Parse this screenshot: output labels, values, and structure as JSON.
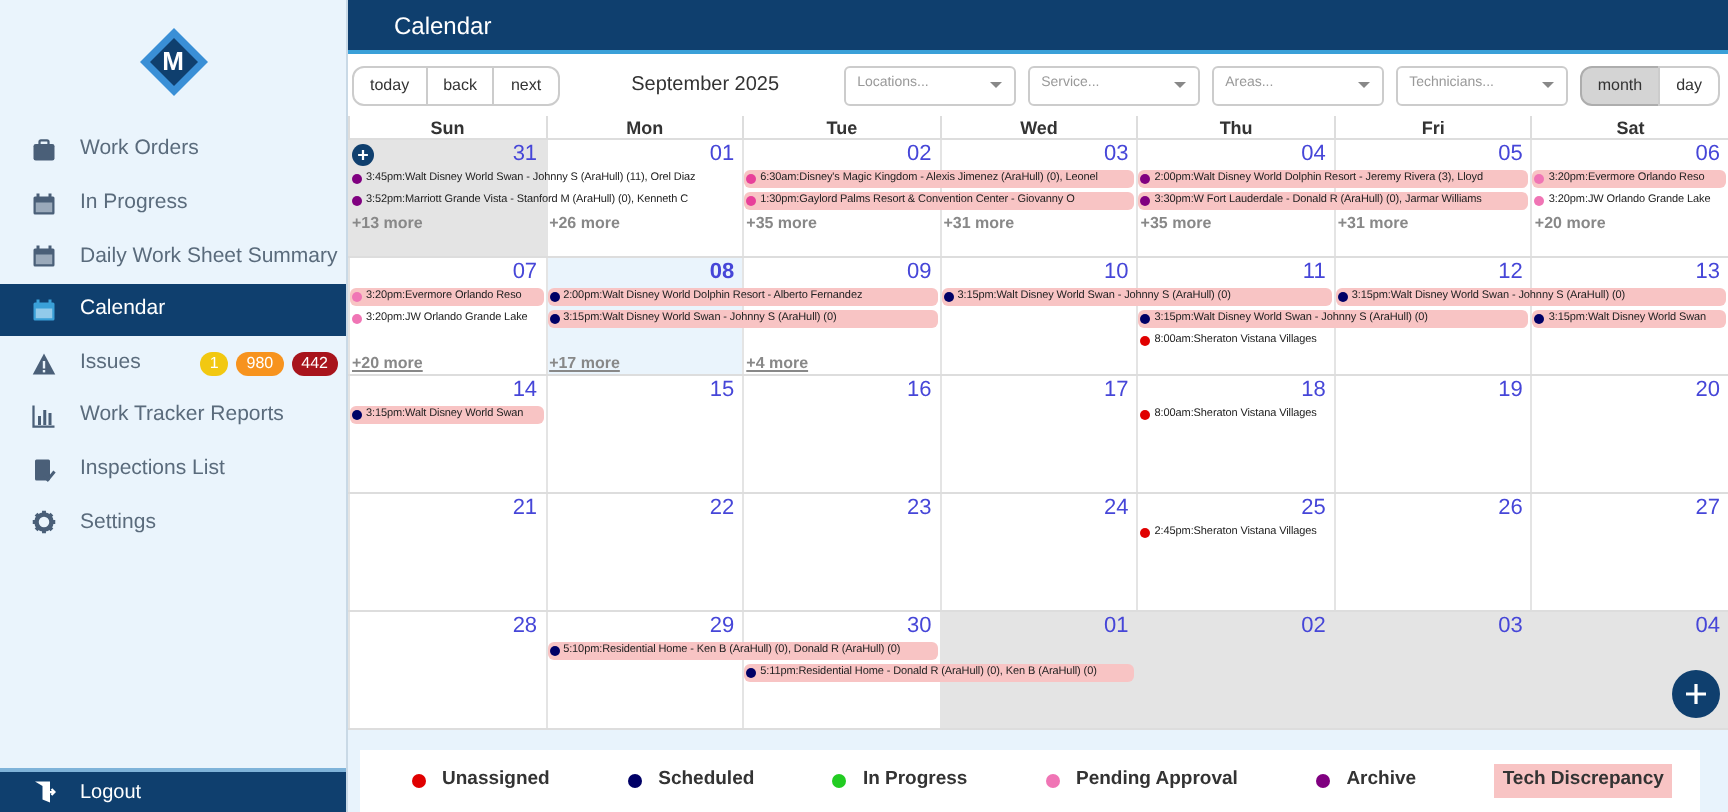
{
  "sidebar": {
    "logo": "M",
    "items": [
      {
        "label": "Work Orders",
        "selected": false
      },
      {
        "label": "In Progress",
        "selected": false
      },
      {
        "label": "Daily Work Sheet Summary",
        "selected": false
      },
      {
        "label": "Calendar",
        "selected": true
      },
      {
        "label": "Issues",
        "selected": false,
        "badges": [
          {
            "text": "1",
            "color": "#f2c811"
          },
          {
            "text": "980",
            "color": "#f7931e"
          },
          {
            "text": "442",
            "color": "#a8141c"
          }
        ]
      },
      {
        "label": "Work Tracker Reports",
        "selected": false
      },
      {
        "label": "Inspections List",
        "selected": false
      },
      {
        "label": "Settings",
        "selected": false
      }
    ],
    "logout": "Logout"
  },
  "header": {
    "title": "Calendar"
  },
  "toolbar": {
    "nav_buttons": [
      "today",
      "back",
      "next"
    ],
    "period": "September 2025",
    "filters": [
      {
        "placeholder": "Locations..."
      },
      {
        "placeholder": "Service..."
      },
      {
        "placeholder": "Areas..."
      },
      {
        "placeholder": "Technicians..."
      }
    ],
    "views": [
      {
        "label": "month",
        "selected": true
      },
      {
        "label": "day",
        "selected": false
      }
    ]
  },
  "calendar": {
    "weekdays": [
      "Sun",
      "Mon",
      "Tue",
      "Wed",
      "Thu",
      "Fri",
      "Sat"
    ],
    "weeks": [
      {
        "days": [
          {
            "number": "31",
            "outside_month": true,
            "today": false
          },
          {
            "number": "01",
            "outside_month": false,
            "today": false
          },
          {
            "number": "02",
            "outside_month": false,
            "today": false
          },
          {
            "number": "03",
            "outside_month": false,
            "today": false
          },
          {
            "number": "04",
            "outside_month": false,
            "today": false
          },
          {
            "number": "05",
            "outside_month": false,
            "today": false
          },
          {
            "number": "06",
            "outside_month": false,
            "today": false
          }
        ],
        "lanes": [
          [
            {
              "kind": "event",
              "text": "3:45pm:Walt Disney World Swan - Johnny S (AraHull) (11), Orel Diaz",
              "color": "#800080",
              "highlight": false
            },
            {
              "kind": "continued"
            },
            {
              "kind": "event",
              "text": "6:30am:Disney's Magic Kingdom - Alexis Jimenez (AraHull) (0), Leonel",
              "color": "#e8409a",
              "highlight": true
            },
            {
              "kind": "continued"
            },
            {
              "kind": "event",
              "text": "2:00pm:Walt Disney World Dolphin Resort - Jeremy Rivera (3), Lloyd",
              "color": "#800080",
              "highlight": true
            },
            {
              "kind": "continued"
            },
            {
              "kind": "event",
              "text": "3:20pm:Evermore Orlando Reso",
              "color": "#f075b5",
              "highlight": true
            }
          ],
          [
            {
              "kind": "event",
              "text": "3:52pm:Marriott Grande Vista - Stanford M (AraHull) (0), Kenneth C",
              "color": "#800080",
              "highlight": false
            },
            {
              "kind": "continued"
            },
            {
              "kind": "event",
              "text": "1:30pm:Gaylord Palms Resort & Convention Center - Giovanny O",
              "color": "#e8409a",
              "highlight": true
            },
            {
              "kind": "continued"
            },
            {
              "kind": "event",
              "text": "3:30pm:W Fort Lauderdale - Donald R (AraHull) (0), Jarmar Williams",
              "color": "#800080",
              "highlight": true
            },
            {
              "kind": "continued"
            },
            {
              "kind": "event",
              "text": "3:20pm:JW Orlando Grande Lake",
              "color": "#f075b5",
              "highlight": false
            }
          ]
        ],
        "more": [
          "+13 more",
          "+26 more",
          "+35 more",
          "+31 more",
          "+35 more",
          "+31 more",
          "+20 more"
        ]
      },
      {
        "days": [
          {
            "number": "07",
            "outside_month": false,
            "today": false
          },
          {
            "number": "08",
            "outside_month": false,
            "today": true
          },
          {
            "number": "09",
            "outside_month": false,
            "today": false
          },
          {
            "number": "10",
            "outside_month": false,
            "today": false
          },
          {
            "number": "11",
            "outside_month": false,
            "today": false
          },
          {
            "number": "12",
            "outside_month": false,
            "today": false
          },
          {
            "number": "13",
            "outside_month": false,
            "today": false
          }
        ],
        "lanes": [
          [
            {
              "kind": "event",
              "text": "3:20pm:Evermore Orlando Reso",
              "color": "#f075b5",
              "highlight": true
            },
            {
              "kind": "event",
              "text": "2:00pm:Walt Disney World Dolphin Resort - Alberto Fernandez",
              "color": "#000066",
              "highlight": true
            },
            {
              "kind": "continued"
            },
            {
              "kind": "event",
              "text": "3:15pm:Walt Disney World Swan - Johnny S (AraHull) (0)",
              "color": "#000066",
              "highlight": true
            },
            {
              "kind": "continued"
            },
            {
              "kind": "event",
              "text": "3:15pm:Walt Disney World Swan - Johnny S (AraHull) (0)",
              "color": "#000066",
              "highlight": true
            },
            {
              "kind": "continued"
            }
          ],
          [
            {
              "kind": "event",
              "text": "3:20pm:JW Orlando Grande Lake",
              "color": "#f075b5",
              "highlight": false
            },
            {
              "kind": "event",
              "text": "3:15pm:Walt Disney World Swan - Johnny S (AraHull) (0)",
              "color": "#000066",
              "highlight": true
            },
            {
              "kind": "continued"
            },
            {
              "kind": "empty"
            },
            {
              "kind": "event",
              "text": "3:15pm:Walt Disney World Swan - Johnny S (AraHull) (0)",
              "color": "#000066",
              "highlight": true
            },
            {
              "kind": "continued"
            },
            {
              "kind": "event",
              "text": "3:15pm:Walt Disney World Swan",
              "color": "#000066",
              "highlight": true
            }
          ],
          [
            {
              "kind": "empty"
            },
            {
              "kind": "empty"
            },
            {
              "kind": "empty"
            },
            {
              "kind": "empty"
            },
            {
              "kind": "event",
              "text": "8:00am:Sheraton Vistana Villages",
              "color": "#e00000",
              "highlight": false
            },
            {
              "kind": "empty"
            },
            {
              "kind": "empty"
            }
          ]
        ],
        "more": [
          "+20 more",
          "+17 more",
          "+4 more"
        ]
      },
      {
        "days": [
          {
            "number": "14",
            "outside_month": false,
            "today": false
          },
          {
            "number": "15",
            "outside_month": false,
            "today": false
          },
          {
            "number": "16",
            "outside_month": false,
            "today": false
          },
          {
            "number": "17",
            "outside_month": false,
            "today": false
          },
          {
            "number": "18",
            "outside_month": false,
            "today": false
          },
          {
            "number": "19",
            "outside_month": false,
            "today": false
          },
          {
            "number": "20",
            "outside_month": false,
            "today": false
          }
        ],
        "lanes": [
          [
            {
              "kind": "event",
              "text": "3:15pm:Walt Disney World Swan",
              "color": "#000066",
              "highlight": true
            },
            {
              "kind": "empty"
            },
            {
              "kind": "empty"
            },
            {
              "kind": "empty"
            },
            {
              "kind": "event",
              "text": "8:00am:Sheraton Vistana Villages",
              "color": "#e00000",
              "highlight": false
            },
            {
              "kind": "empty"
            },
            {
              "kind": "empty"
            }
          ]
        ]
      },
      {
        "days": [
          {
            "number": "21",
            "outside_month": false,
            "today": false
          },
          {
            "number": "22",
            "outside_month": false,
            "today": false
          },
          {
            "number": "23",
            "outside_month": false,
            "today": false
          },
          {
            "number": "24",
            "outside_month": false,
            "today": false
          },
          {
            "number": "25",
            "outside_month": false,
            "today": false
          },
          {
            "number": "26",
            "outside_month": false,
            "today": false
          },
          {
            "number": "27",
            "outside_month": false,
            "today": false
          }
        ],
        "lanes": [
          [
            {
              "kind": "empty"
            },
            {
              "kind": "empty"
            },
            {
              "kind": "empty"
            },
            {
              "kind": "empty"
            },
            {
              "kind": "event",
              "text": "2:45pm:Sheraton Vistana Villages",
              "color": "#e00000",
              "highlight": false
            },
            {
              "kind": "empty"
            },
            {
              "kind": "empty"
            }
          ]
        ]
      },
      {
        "days": [
          {
            "number": "28",
            "outside_month": false,
            "today": false
          },
          {
            "number": "29",
            "outside_month": false,
            "today": false
          },
          {
            "number": "30",
            "outside_month": false,
            "today": false
          },
          {
            "number": "01",
            "outside_month": true,
            "today": false
          },
          {
            "number": "02",
            "outside_month": true,
            "today": false
          },
          {
            "number": "03",
            "outside_month": true,
            "today": false
          },
          {
            "number": "04",
            "outside_month": true,
            "today": false
          }
        ],
        "lanes": [
          [
            {
              "kind": "empty"
            },
            {
              "kind": "event",
              "text": "5:10pm:Residential Home - Ken B (AraHull) (0), Donald R (AraHull) (0)",
              "color": "#000066",
              "highlight": true
            },
            {
              "kind": "continued"
            },
            {
              "kind": "empty"
            },
            {
              "kind": "empty"
            },
            {
              "kind": "empty"
            },
            {
              "kind": "empty"
            }
          ],
          [
            {
              "kind": "empty"
            },
            {
              "kind": "empty"
            },
            {
              "kind": "event",
              "text": "5:11pm:Residential Home - Donald R (AraHull) (0), Ken B (AraHull) (0)",
              "color": "#000066",
              "highlight": true
            },
            {
              "kind": "continued"
            },
            {
              "kind": "empty"
            },
            {
              "kind": "empty"
            },
            {
              "kind": "empty"
            }
          ]
        ]
      }
    ]
  },
  "legend": [
    {
      "kind": "dot",
      "label": "Unassigned",
      "color": "#e00000"
    },
    {
      "kind": "dot",
      "label": "Scheduled",
      "color": "#000066"
    },
    {
      "kind": "dot",
      "label": "In Progress",
      "color": "#22cc22"
    },
    {
      "kind": "dot",
      "label": "Pending Approval",
      "color": "#f075b5"
    },
    {
      "kind": "dot",
      "label": "Archive",
      "color": "#800080"
    },
    {
      "kind": "highlight",
      "label": "Tech Discrepancy",
      "color": "#f8c4c4"
    }
  ]
}
